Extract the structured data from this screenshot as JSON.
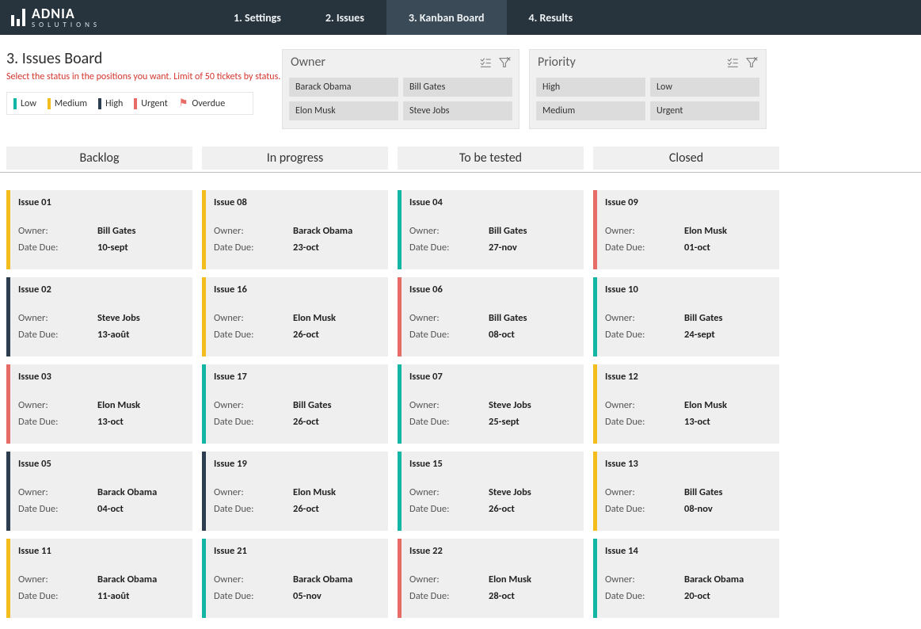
{
  "brand": {
    "name": "ADNIA",
    "sub": "SOLUTIONS"
  },
  "tabs": [
    {
      "label": "1. Settings"
    },
    {
      "label": "2. Issues"
    },
    {
      "label": "3. Kanban Board",
      "active": true
    },
    {
      "label": "4. Results"
    }
  ],
  "page_title": "3. Issues Board",
  "subtitle": "Select the status in the positions you want. Limit of 50 tickets by status.",
  "legend": {
    "low": "Low",
    "medium": "Medium",
    "high": "High",
    "urgent": "Urgent",
    "overdue": "Overdue"
  },
  "slicers": {
    "owner": {
      "title": "Owner",
      "items": [
        "Barack Obama",
        "Bill Gates",
        "Elon Musk",
        "Steve Jobs"
      ]
    },
    "priority": {
      "title": "Priority",
      "items": [
        "High",
        "Low",
        "Medium",
        "Urgent"
      ]
    }
  },
  "labels": {
    "owner": "Owner:",
    "due": "Date Due:"
  },
  "priority_colors": {
    "low": "#13b6a4",
    "medium": "#f2bd1d",
    "high": "#2d3e50",
    "urgent": "#e76b66"
  },
  "columns": [
    {
      "title": "Backlog",
      "cards": [
        {
          "id": "Issue 01",
          "owner": "Bill Gates",
          "due": "10-sept",
          "priority": "medium"
        },
        {
          "id": "Issue 02",
          "owner": "Steve Jobs",
          "due": "13-août",
          "priority": "high"
        },
        {
          "id": "Issue 03",
          "owner": "Elon Musk",
          "due": "13-oct",
          "priority": "urgent"
        },
        {
          "id": "Issue 05",
          "owner": "Barack Obama",
          "due": "04-oct",
          "priority": "high"
        },
        {
          "id": "Issue 11",
          "owner": "Barack Obama",
          "due": "11-août",
          "priority": "medium"
        }
      ]
    },
    {
      "title": "In progress",
      "cards": [
        {
          "id": "Issue 08",
          "owner": "Barack Obama",
          "due": "23-oct",
          "priority": "medium"
        },
        {
          "id": "Issue 16",
          "owner": "Elon Musk",
          "due": "26-oct",
          "priority": "medium"
        },
        {
          "id": "Issue 17",
          "owner": "Bill Gates",
          "due": "26-oct",
          "priority": "low"
        },
        {
          "id": "Issue 19",
          "owner": "Elon Musk",
          "due": "26-oct",
          "priority": "high"
        },
        {
          "id": "Issue 21",
          "owner": "Barack Obama",
          "due": "05-nov",
          "priority": "low"
        }
      ]
    },
    {
      "title": "To be tested",
      "cards": [
        {
          "id": "Issue 04",
          "owner": "Bill Gates",
          "due": "27-nov",
          "priority": "low"
        },
        {
          "id": "Issue 06",
          "owner": "Bill Gates",
          "due": "08-oct",
          "priority": "urgent"
        },
        {
          "id": "Issue 07",
          "owner": "Steve Jobs",
          "due": "25-sept",
          "priority": "low"
        },
        {
          "id": "Issue 15",
          "owner": "Steve Jobs",
          "due": "26-oct",
          "priority": "low"
        },
        {
          "id": "Issue 22",
          "owner": "Elon Musk",
          "due": "28-oct",
          "priority": "urgent"
        }
      ]
    },
    {
      "title": "Closed",
      "cards": [
        {
          "id": "Issue 09",
          "owner": "Elon Musk",
          "due": "01-oct",
          "priority": "urgent"
        },
        {
          "id": "Issue 10",
          "owner": "Bill Gates",
          "due": "24-sept",
          "priority": "low"
        },
        {
          "id": "Issue 12",
          "owner": "Elon Musk",
          "due": "13-oct",
          "priority": "medium"
        },
        {
          "id": "Issue 13",
          "owner": "Bill Gates",
          "due": "08-nov",
          "priority": "medium"
        },
        {
          "id": "Issue 14",
          "owner": "Barack Obama",
          "due": "20-oct",
          "priority": "low"
        }
      ]
    }
  ]
}
